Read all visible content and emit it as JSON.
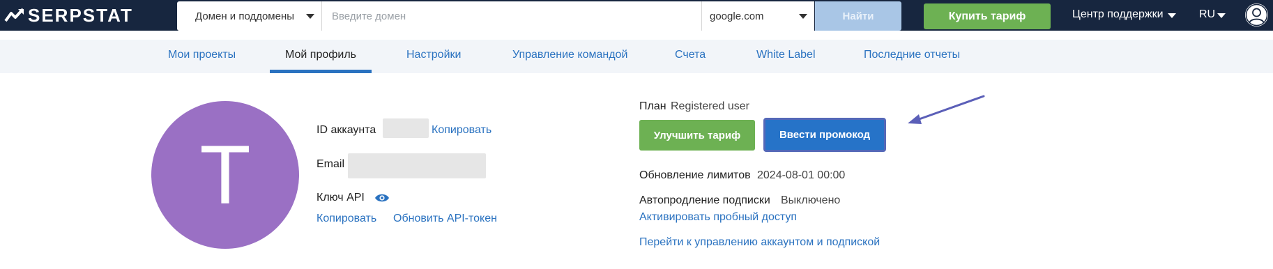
{
  "header": {
    "logo_text": "SERPSTAT",
    "search_scope": "Домен и поддомены",
    "search_placeholder": "Введите домен",
    "engine": "google.com",
    "find_label": "Найти",
    "buy_label": "Купить тариф",
    "support_label": "Центр поддержки",
    "lang_label": "RU"
  },
  "tabs": [
    {
      "label": "Мои проекты",
      "active": false
    },
    {
      "label": "Мой профиль",
      "active": true
    },
    {
      "label": "Настройки",
      "active": false
    },
    {
      "label": "Управление командой",
      "active": false
    },
    {
      "label": "Счета",
      "active": false
    },
    {
      "label": "White Label",
      "active": false
    },
    {
      "label": "Последние отчеты",
      "active": false
    }
  ],
  "profile": {
    "avatar_letter": "T",
    "account_id_label": "ID аккаунта",
    "copy_label": "Копировать",
    "email_label": "Email",
    "api_key_label": "Ключ API",
    "api_copy_label": "Копировать",
    "api_refresh_label": "Обновить API-токен"
  },
  "plan": {
    "plan_label": "План",
    "plan_value": "Registered user",
    "upgrade_label": "Улучшить тариф",
    "promo_label": "Ввести промокод",
    "limits_label": "Обновление лимитов",
    "limits_value": "2024-08-01 00:00",
    "autorenew_label": "Автопродление подписки",
    "autorenew_value": "Выключено",
    "trial_link": "Активировать пробный доступ",
    "manage_link": "Перейти к управлению аккаунтом и подпиской"
  },
  "colors": {
    "topbar": "#17263f",
    "accent_blue": "#2a72c0",
    "green": "#6db153",
    "avatar": "#9a70c4",
    "arrow": "#5b5fb8"
  }
}
